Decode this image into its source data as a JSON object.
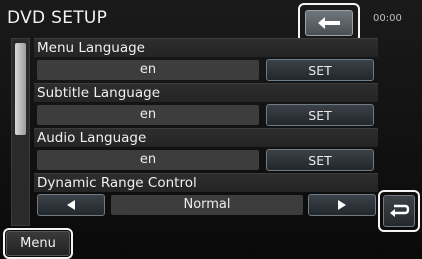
{
  "header": {
    "title": "DVD SETUP",
    "clock": "00:00"
  },
  "icons": {
    "back": "back-arrow-icon",
    "return": "return-icon",
    "left": "left-triangle-icon",
    "right": "right-triangle-icon"
  },
  "settings": {
    "menu_language": {
      "label": "Menu Language",
      "value": "en",
      "button": "SET"
    },
    "subtitle_language": {
      "label": "Subtitle Language",
      "value": "en",
      "button": "SET"
    },
    "audio_language": {
      "label": "Audio Language",
      "value": "en",
      "button": "SET"
    },
    "dynamic_range": {
      "label": "Dynamic Range Control",
      "value": "Normal"
    }
  },
  "footer": {
    "menu_label": "Menu"
  },
  "colors": {
    "highlight": "#f4f4f4",
    "button_border": "#6e7a84",
    "background": "#0c0c0c"
  }
}
